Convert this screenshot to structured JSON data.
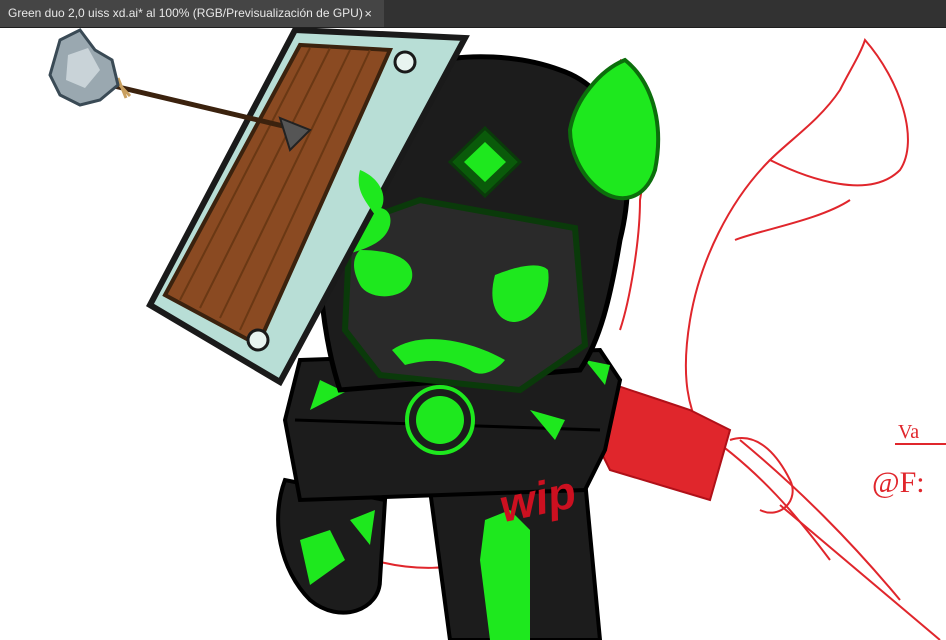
{
  "document_tab": {
    "title": "Green duo 2,0 uiss xd.ai* al 100% (RGB/Previsualización de GPU)",
    "close_glyph": "×"
  },
  "artwork": {
    "watermark": "wip",
    "side_text_1": "Va",
    "side_text_2": "@F:",
    "colors": {
      "body": "#1c1c1c",
      "accent_green": "#1ee81e",
      "sketch_red": "#e0262c",
      "shield_wood": "#8a4a22",
      "shield_rim": "#b8ded6"
    }
  }
}
